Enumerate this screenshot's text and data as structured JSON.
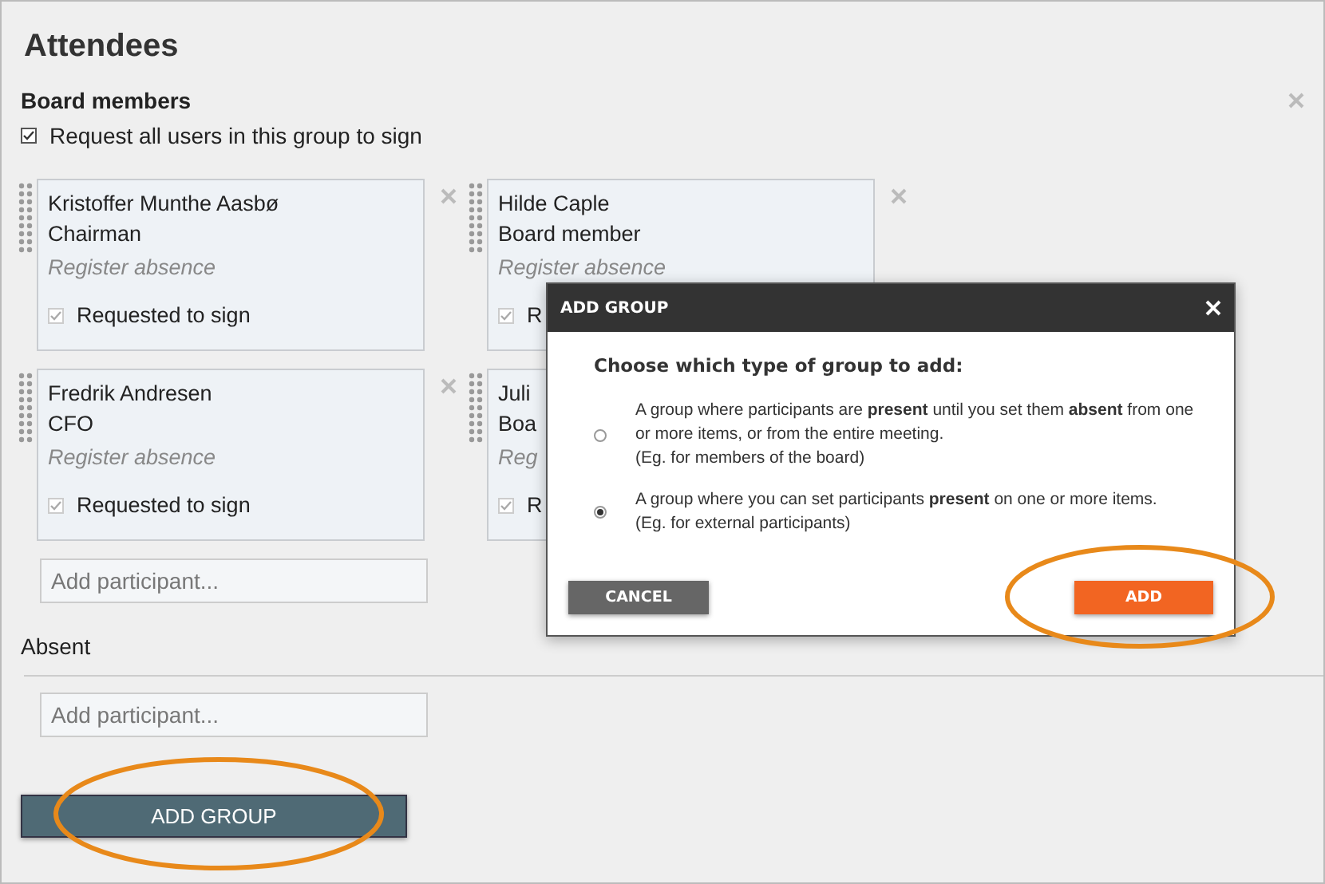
{
  "page": {
    "title": "Attendees"
  },
  "group": {
    "title": "Board members",
    "sign_all": {
      "label": "Request all users in this group to sign",
      "checked": true
    },
    "members": [
      {
        "name": "Kristoffer Munthe Aasbø",
        "role": "Chairman",
        "absence": "Register absence",
        "sign_label": "Requested to sign",
        "sign_checked": true
      },
      {
        "name": "Hilde Caple",
        "role": "Board member",
        "absence": "Register absence",
        "sign_label": "R",
        "sign_checked": true
      },
      {
        "name": "Fredrik Andresen",
        "role": "CFO",
        "absence": "Register absence",
        "sign_label": "Requested to sign",
        "sign_checked": true
      },
      {
        "name": "Juli",
        "role": "Boa",
        "absence": "Reg",
        "sign_label": "R",
        "sign_checked": true
      }
    ],
    "add_participant": {
      "placeholder": "Add participant..."
    }
  },
  "absent": {
    "title": "Absent",
    "add_participant": {
      "placeholder": "Add participant..."
    }
  },
  "add_group_button": "ADD GROUP",
  "dialog": {
    "title": "ADD GROUP",
    "prompt": "Choose which type of group to add:",
    "options": [
      {
        "lines": [
          "A group where participants are **present** until you set them **absent** from one",
          "or more items, or from the entire meeting.",
          "(Eg. for members of the board)"
        ],
        "selected": false
      },
      {
        "lines": [
          "A group where you can set participants **present** on one or more items.",
          "(Eg. for external participants)"
        ],
        "selected": true
      }
    ],
    "cancel": "CANCEL",
    "add": "ADD"
  }
}
